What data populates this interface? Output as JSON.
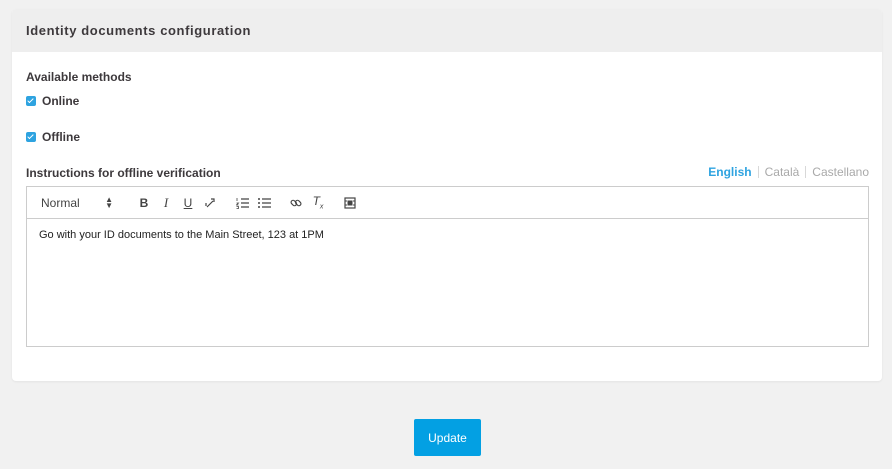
{
  "card": {
    "title": "Identity documents configuration"
  },
  "methods": {
    "label": "Available methods",
    "options": [
      {
        "label": "Online",
        "checked": true
      },
      {
        "label": "Offline",
        "checked": true
      }
    ]
  },
  "instructions": {
    "label": "Instructions for offline verification",
    "languages": [
      "English",
      "Català",
      "Castellano"
    ],
    "active_language": "English"
  },
  "editor": {
    "format_select": "Normal",
    "tools": [
      "bold-icon",
      "italic-icon",
      "underline-icon",
      "link-break-icon",
      "ordered-list-icon",
      "bullet-list-icon",
      "link-icon",
      "clear-format-icon",
      "video-icon"
    ],
    "content": "Go with your ID documents to the Main Street, 123 at 1PM"
  },
  "actions": {
    "update_label": "Update"
  },
  "colors": {
    "accent": "#2ea3e0",
    "button": "#03a0e3",
    "page_bg": "#f1f1f1",
    "header_bg": "#eeeeee"
  }
}
